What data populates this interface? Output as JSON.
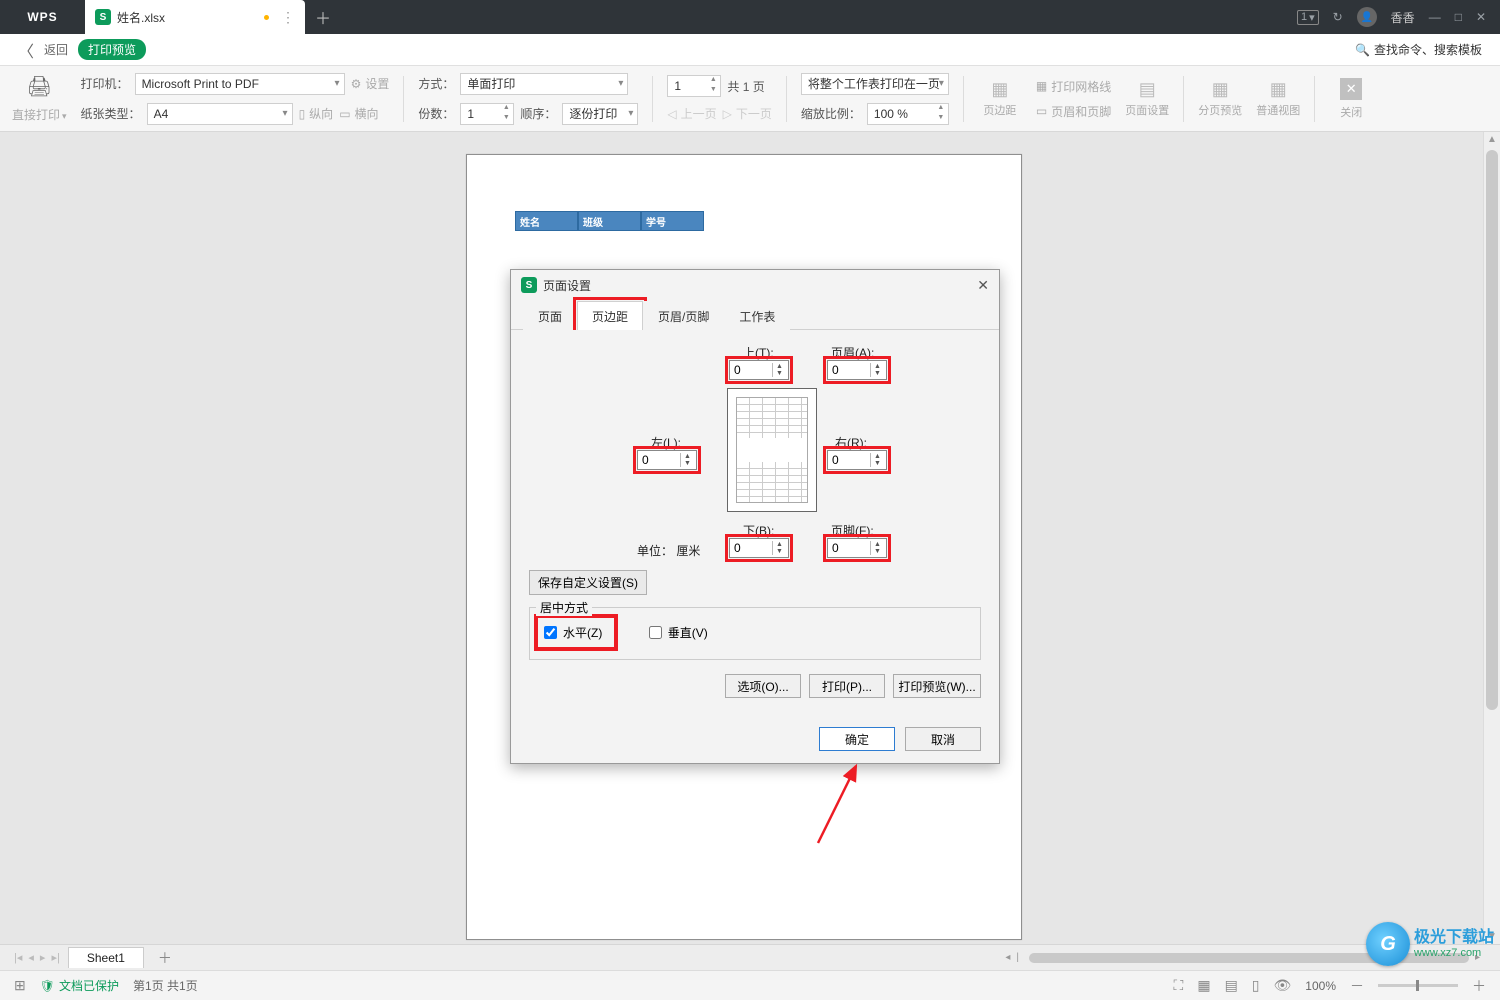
{
  "titlebar": {
    "app": "WPS",
    "filename": "姓名.xlsx",
    "file_badge": "S",
    "newtab": "＋",
    "badge_count": "1",
    "username": "香香",
    "win_min": "—",
    "win_max": "□",
    "win_close": "✕"
  },
  "retbar": {
    "back_icon": "〈",
    "back": "返回",
    "badge": "打印预览",
    "search_icon": "🔍",
    "search": "查找命令、搜索模板"
  },
  "ribbon": {
    "direct_print": "直接打印",
    "direct_print_caret": "▾",
    "printer_label": "打印机：",
    "printer_value": "Microsoft Print to PDF",
    "settings_icon": "⚙",
    "settings": "设置",
    "paper_label": "纸张类型：",
    "paper_value": "A4",
    "portrait": "纵向",
    "landscape": "横向",
    "mode_label": "方式：",
    "mode_value": "单面打印",
    "copies_label": "份数：",
    "copies_value": "1",
    "order_label": "顺序：",
    "order_value": "逐份打印",
    "page_value": "1",
    "page_total": "共 1 页",
    "prev": "上一页",
    "next": "下一页",
    "fit_label": "将整个工作表打印在一页",
    "scale_label": "缩放比例：",
    "scale_value": "100 %",
    "margins": "页边距",
    "headerfooter": "页眉和页脚",
    "grid": "打印网格线",
    "pagesetup": "页面设置",
    "pagebreak": "分页预览",
    "normal": "普通视图",
    "close": "关闭"
  },
  "preview_table": {
    "h1": "姓名",
    "h2": "班级",
    "h3": "学号"
  },
  "dialog": {
    "title": "页面设置",
    "icon": "S",
    "close": "✕",
    "tabs": {
      "page": "页面",
      "margins": "页边距",
      "hf": "页眉/页脚",
      "sheet": "工作表"
    },
    "labels": {
      "top": "上(T):",
      "header": "页眉(A):",
      "left": "左(L):",
      "right": "右(R):",
      "bottom": "下(B):",
      "footer": "页脚(F):",
      "unit_lbl": "单位：",
      "unit_val": "厘米"
    },
    "values": {
      "top": "0",
      "header": "0",
      "left": "0",
      "right": "0",
      "bottom": "0",
      "footer": "0"
    },
    "save_custom": "保存自定义设置(S)",
    "center_legend": "居中方式",
    "horiz": "水平(Z)",
    "vert": "垂直(V)",
    "options": "选项(O)...",
    "print": "打印(P)...",
    "preview": "打印预览(W)...",
    "ok": "确定",
    "cancel": "取消"
  },
  "sheettabs": {
    "sheet1": "Sheet1",
    "plus": "＋"
  },
  "status": {
    "protected": "文档已保护",
    "pageinfo": "第1页 共1页",
    "zoom": "100%",
    "minus": "－",
    "plus": "＋"
  },
  "watermark": {
    "cn": "极光下载站",
    "url": "www.xz7.com",
    "logo": "G"
  }
}
